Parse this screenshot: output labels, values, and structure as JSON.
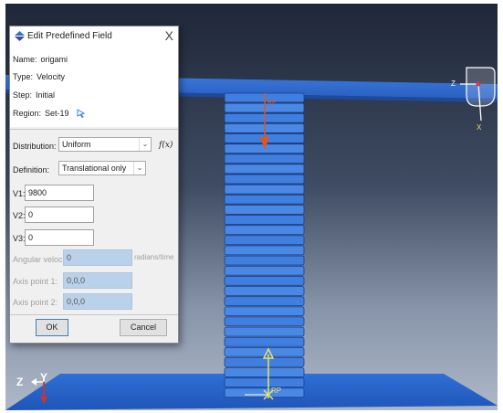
{
  "dialog": {
    "title": "Edit Predefined Field",
    "close_glyph": "X",
    "name_label": "Name:",
    "name_value": "origami",
    "type_label": "Type:",
    "type_value": "Velocity",
    "step_label": "Step:",
    "step_value": "Initial",
    "region_label": "Region:",
    "region_value": "Set-19",
    "distribution_label": "Distribution:",
    "distribution_value": "Uniform",
    "fx_label": "f(x)",
    "definition_label": "Definition:",
    "definition_value": "Translational only",
    "v1_label": "V1:",
    "v1_value": "9800",
    "v2_label": "V2:",
    "v2_value": "0",
    "v3_label": "V3:",
    "v3_value": "0",
    "angular_label": "Angular velocity:",
    "angular_value": "0",
    "angular_unit": "radians/time",
    "axis1_label": "Axis point 1:",
    "axis1_value": "0,0,0",
    "axis2_label": "Axis point 2:",
    "axis2_value": "0,0,0",
    "ok_label": "OK",
    "cancel_label": "Cancel"
  },
  "viewport": {
    "background_top": "#1f2738",
    "background_bottom": "#aeb8c8",
    "plate_color": "#2f6fd6",
    "model_color": "#3f7fe0",
    "top_triad": {
      "z": "Z",
      "x": "X"
    },
    "bottom_triad": {
      "z": "Z",
      "y": "Y"
    },
    "rp_label": "RP"
  }
}
